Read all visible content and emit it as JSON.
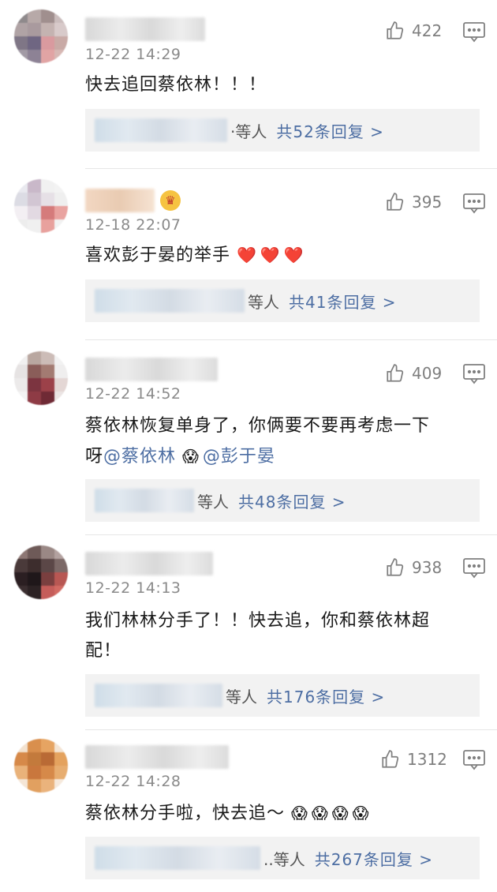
{
  "comments": [
    {
      "time": "12-22 14:29",
      "likes": "422",
      "text": "快去追回蔡依林！！！",
      "more_suffix": "·等人",
      "reply_count": "共52条回复 >",
      "avatar_colors": [
        "#8f8a8c",
        "#b7a9a8",
        "#a08f8e",
        "#cbbdbd",
        "#7f7686",
        "#6f6682",
        "#d99a9f",
        "#c9aaa6"
      ]
    },
    {
      "time": "12-18 22:07",
      "likes": "395",
      "text": "喜欢彭于晏的举手",
      "emojis": [
        "❤️",
        "❤️",
        "❤️"
      ],
      "more_suffix": "等人",
      "reply_count": "共41条回复 >",
      "avatar_colors": [
        "#e9e9ef",
        "#c9b8c9",
        "#f1f1f1",
        "#dcdce4",
        "#f3eff3",
        "#d57b7b",
        "#ededed",
        "#f0f0f0"
      ]
    },
    {
      "time": "12-22 14:52",
      "likes": "409",
      "text_line1": "蔡依林恢复单身了，你俩要不要再考虑一下",
      "text_line2_prefix": "呀",
      "mention1": "@蔡依林",
      "mention2": "@彭于晏",
      "emoji": "😱",
      "more_suffix": "等人",
      "reply_count": "共48条回复 >",
      "avatar_colors": [
        "#e6e3e3",
        "#b9a7a0",
        "#f0eded",
        "#8a5d59",
        "#7c3440",
        "#9c4149",
        "#f1f0f0",
        "#e4d7d5"
      ]
    },
    {
      "time": "12-22 14:13",
      "likes": "938",
      "text_line1": "我们林林分手了！！快去追，你和蔡依林超",
      "text_line2": "配！",
      "more_suffix": "等人",
      "reply_count": "共176条回复 >",
      "avatar_colors": [
        "#6e5a58",
        "#3d2d2d",
        "#8d7774",
        "#2b1f22",
        "#7a3f3f",
        "#b85753",
        "#4a3a3a",
        "#c55d5a"
      ]
    },
    {
      "time": "12-22 14:28",
      "likes": "1312",
      "text": "蔡依林分手啦，快去追～",
      "emojis": [
        "😱",
        "😱",
        "😱",
        "😱"
      ],
      "more_suffix": "..等人",
      "reply_count": "共267条回复 >",
      "avatar_colors": [
        "#d98f4d",
        "#c37a3c",
        "#e6a462",
        "#b96a35",
        "#e9b27a",
        "#d68949",
        "#c9773d",
        "#e4a25e"
      ]
    }
  ],
  "colors": {
    "link": "#4d6ea3",
    "meta": "#8a8a8a",
    "reply_bg": "#f2f2f2"
  },
  "icons": {
    "like": "thumbs-up-icon",
    "reply": "comment-icon",
    "crown": "crown-badge-icon"
  }
}
